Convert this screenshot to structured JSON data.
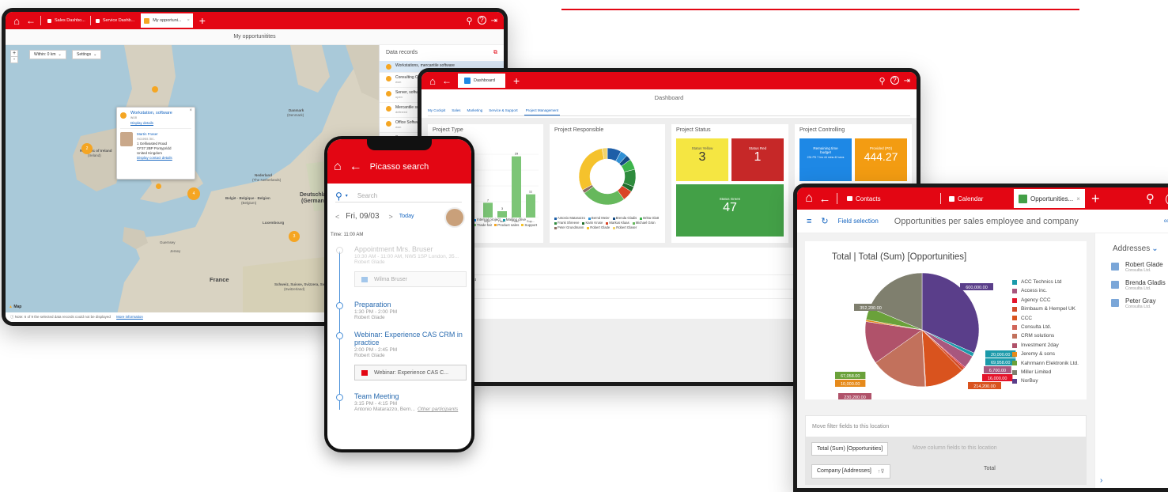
{
  "map_window": {
    "tabs": [
      "Sales Dashbo...",
      "Service Dashb...",
      "My opportuni..."
    ],
    "title": "My opportunitites",
    "zoom_in": "+",
    "zoom_out": "-",
    "within_label": "Within: 0 km",
    "settings_label": "Settings",
    "panel_title": "Data records",
    "records": [
      {
        "title": "Workstations, mercantile software",
        "sub": ""
      },
      {
        "title": "Consulting Opp...",
        "sub": "won"
      },
      {
        "title": "Server, software",
        "sub": "open"
      },
      {
        "title": "Mercantile softw...",
        "sub": "deferred"
      },
      {
        "title": "Office Software",
        "sub": "won"
      },
      {
        "title": "Server, mercanti...",
        "sub": "won"
      }
    ],
    "popup": {
      "title": "Workstation, software",
      "status": "won",
      "details_link": "Display details",
      "person": "Martin Fraser",
      "company": "Access inc.",
      "address1": "1 Gellivasted Road",
      "address2": "CF37 2BP Pontypridd",
      "address3": "United Kingdom",
      "contact_link": "Display contact details"
    },
    "labels": {
      "republic": "Republic of Ireland",
      "ireland": "(Ireland)",
      "nederland": "Nederland",
      "netherlands": "(The Netherlands)",
      "belgie": "België · Belgique · Belgien",
      "belgium": "(Belgium)",
      "deutschland": "Deutschla",
      "germany": "(Germany)",
      "luxembourg": "Luxembourg",
      "france": "France",
      "switzerland": "Schweiz, Suisse, Svizzera, Svizra",
      "switzerland2": "(Switzerland)",
      "danmark": "Danmark",
      "denmark": "(Denmark)",
      "guernsey": "Guernsey",
      "jersey": "Jersey",
      "map_logo": "Map"
    },
    "clusters": [
      "4",
      "3",
      "2"
    ],
    "footer_note": "Note: 6 of 9 the selected data records could not be displayed",
    "footer_link": "More information"
  },
  "dashboard_window": {
    "tab": "Dashboard",
    "title": "Dashboard",
    "subtabs": [
      "My Cockpit",
      "Sales",
      "Marketing",
      "Service & Support",
      "Project Management"
    ],
    "project_type": {
      "title": "Project Type",
      "legend": [
        "Internal project",
        "Mailing drive",
        "Trade fair",
        "Product sales",
        "Support"
      ],
      "bar_labels": [
        "7",
        "3",
        "3",
        "29",
        "11"
      ],
      "x_labels": [
        "Impl...",
        "Trad...",
        "Prod...",
        "Sup..."
      ]
    },
    "project_responsible": {
      "title": "Project Responsible",
      "legend": [
        "Antonio Matarazzo",
        "Bernd Meier",
        "Brenda Gladis",
        "Britta Glatt",
        "Frank Shreeve",
        "Karin Kruse",
        "Markus Klaas",
        "Michael Grün",
        "Peter Grundmann",
        "Robert Glade",
        "Robert Glaser"
      ]
    },
    "project_status": {
      "title": "Project Status",
      "yellow_label": "Status Yellow",
      "yellow_value": "3",
      "red_label": "Status Red",
      "red_value": "1",
      "green_label": "Status Green",
      "green_value": "47"
    },
    "project_controlling": {
      "title": "Project Controlling",
      "remaining_label": "Remaining time budget",
      "remaining_sub": "231 PD 7 hrs 44 mins 42 secs",
      "provided_label": "Provided (PD)",
      "provided_value": "444.27"
    },
    "list_rows": [
      "roject",
      "tion"
    ]
  },
  "phone": {
    "title": "Picasso search",
    "search_placeholder": "Search",
    "date": "Fri, 09/03",
    "today": "Today",
    "time_label": "Time: 11:00 AM",
    "events": [
      {
        "title": "Appointment Mrs. Bruser",
        "time": "10:30 AM - 11:00 AM, NW5 1SP London, 35...",
        "person": "Robert Glade",
        "attachment": "Wilma Bruser",
        "faded": true
      },
      {
        "title": "Preparation",
        "time": "1:30 PM - 2:00 PM",
        "person": "Robert Glade",
        "attachment": "",
        "faded": false
      },
      {
        "title": "Webinar: Experience CAS CRM in practice",
        "time": "2:00 PM - 2:45 PM",
        "person": "Robert Glade",
        "attachment": "Webinar: Experience CAS C...",
        "faded": false
      },
      {
        "title": "Team Meeting",
        "time": "3:15 PM - 4:15 PM",
        "person": "Antonio Matarazzo, Bern...",
        "other": "Other participants",
        "attachment": "",
        "faded": false
      }
    ]
  },
  "opportunities_window": {
    "tabs": [
      "Contacts",
      "Calendar",
      "Opportunities..."
    ],
    "field_selection": "Field selection",
    "title": "Opportunities per sales employee and company",
    "chart_title": "Total | Total (Sum) [Opportunities]",
    "addresses_label": "Addresses",
    "addresses": [
      {
        "name": "Robert Glade",
        "company": "Consulta Ltd."
      },
      {
        "name": "Brenda Gladis",
        "company": "Consulta Ltd."
      },
      {
        "name": "Peter Gray",
        "company": "Consulta Ltd."
      }
    ],
    "filter_label": "Move filter fields to this location",
    "total_sum_label": "Total (Sum) [Opportunities]",
    "column_fields_label": "Move column fields to this location",
    "company_label": "Company [Addresses]",
    "total_label": "Total",
    "more": "ooo"
  },
  "chart_data": [
    {
      "type": "pie",
      "title": "Total | Total (Sum) [Opportunities]",
      "series": [
        {
          "name": "ACC Technics Ltd",
          "value": 20000,
          "color": "#1b9aaa"
        },
        {
          "name": "Access inc.",
          "value": 69958,
          "color": "#a8577e"
        },
        {
          "name": "Agency CCC",
          "value": 6700,
          "color": "#e4142c"
        },
        {
          "name": "Birnbaum & Hempel UK",
          "value": 16000,
          "color": "#d14b2a"
        },
        {
          "name": "CCC",
          "value": 214200,
          "color": "#d9531e"
        },
        {
          "name": "Consulta Ltd.",
          "value": 4000,
          "color": "#d1665a"
        },
        {
          "name": "CRM solutions",
          "value": 304158,
          "color": "#c2715c"
        },
        {
          "name": "Investment 2day",
          "value": 230200,
          "color": "#b0526a"
        },
        {
          "name": "Jeremy & sons",
          "value": 10000,
          "color": "#e68a1b"
        },
        {
          "name": "Kahrmann Elektronik Ltd.",
          "value": 67058,
          "color": "#6aa13a"
        },
        {
          "name": "Miller Limited",
          "value": 352200,
          "color": "#7f7f6e"
        },
        {
          "name": "NorBuy",
          "value": 600000,
          "color": "#5a3e8a"
        }
      ],
      "data_labels": [
        "600,000.00",
        "352,200.00",
        "20,000.00",
        "69,958.00",
        "6,700.00",
        "16,000.00",
        "214,200.00",
        "4,000.00",
        "304,158.00",
        "230,200.00",
        "67,058.00",
        "10,000.00"
      ],
      "legend_position": "right"
    },
    {
      "type": "bar",
      "title": "Project Type",
      "categories": [
        "Impl...",
        "Trad...",
        "Prod...",
        "Sup..."
      ],
      "values": [
        7,
        3,
        29,
        11
      ]
    },
    {
      "type": "pie",
      "title": "Project Responsible",
      "series": [
        {
          "name": "Antonio Matarazzo",
          "value": 8,
          "color": "#1e5fa8"
        },
        {
          "name": "Bernd Meier",
          "value": 4,
          "color": "#2f8fd4"
        },
        {
          "name": "Brenda Gladis",
          "value": 3,
          "color": "#154b83"
        },
        {
          "name": "Britta Glatt",
          "value": 6,
          "color": "#3cb44b"
        },
        {
          "name": "Frank Shreeve",
          "value": 10,
          "color": "#2e8b3d"
        },
        {
          "name": "Karin Kruse",
          "value": 3,
          "color": "#1f6d2b"
        },
        {
          "name": "Markus Klaas",
          "value": 6,
          "color": "#d94426"
        },
        {
          "name": "Michael Grün",
          "value": 25,
          "color": "#66b85c"
        },
        {
          "name": "Peter Grundmann",
          "value": 2,
          "color": "#8d6e63"
        },
        {
          "name": "Robert Glade",
          "value": 30,
          "color": "#f5c22c"
        },
        {
          "name": "Robert Glaser",
          "value": 3,
          "color": "#f1d36b"
        }
      ]
    }
  ]
}
